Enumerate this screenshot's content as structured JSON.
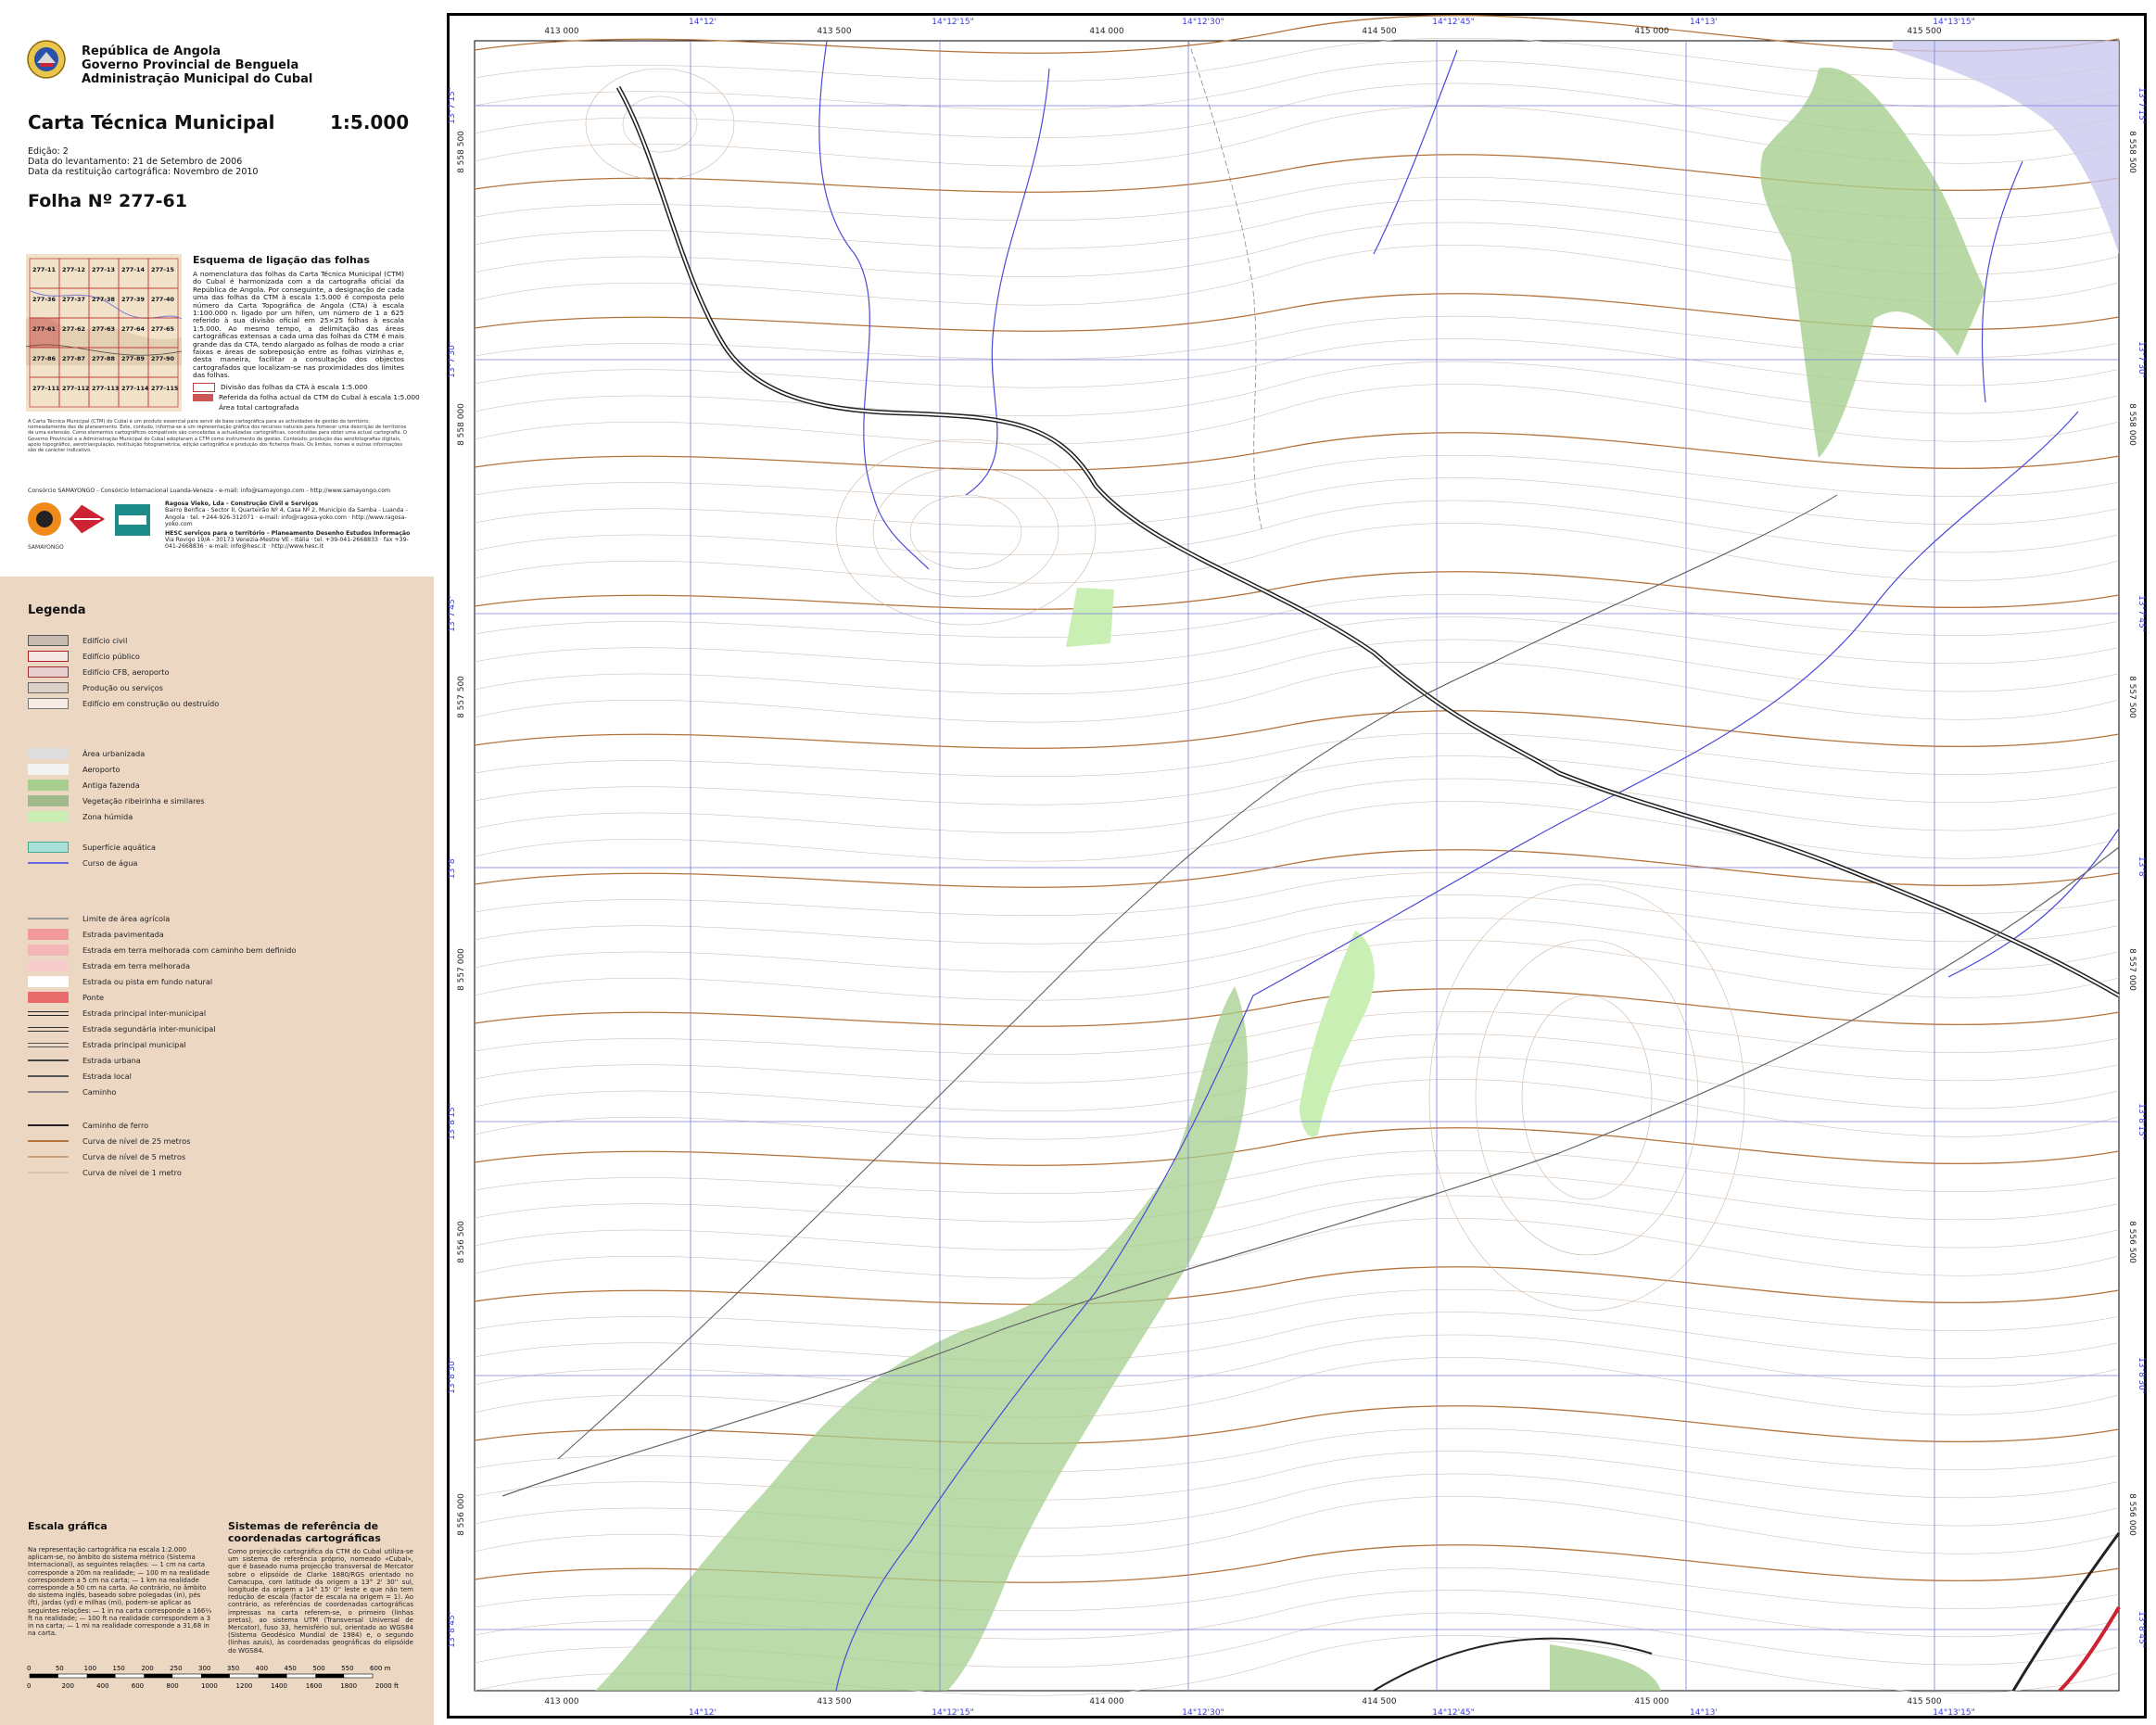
{
  "header": {
    "line1": "República de Angola",
    "line2": "Governo Provincial de Benguela",
    "line3": "Administração Municipal do Cubal"
  },
  "title": "Carta Técnica Municipal",
  "scale": "1:5.000",
  "meta": {
    "edition": "Edição: 2",
    "survey_date": "Data do levantamento: 21 de Setembro de 2006",
    "restitution_date": "Data da restituição cartográfica: Novembro de 2010"
  },
  "sheet": "Folha Nº  277-61",
  "index": {
    "title": "Esquema de ligação das folhas",
    "text": "A nomenclatura das folhas da Carta Técnica Municipal (CTM) do Cubal é harmonizada com a da cartografia oficial da República de Angola. Por conseguinte, a designação de cada uma das folhas da CTM à escala 1:5.000 é composta pelo número da Carta Topográfica de Angola (CTA) à escala 1:100.000 n. ligado por um hífen, um número de 1 a 625 referido à sua divisão oficial em 25×25 folhas à escala 1:5.000. Ao mesmo tempo, a delimitação das áreas cartográficas extensas a cada uma das folhas da CTM é mais grande das da CTA, tendo alargado as folhas de modo a criar faixas e áreas de sobreposição entre as folhas vizinhas e, desta maneira, facilitar a consultação dos objectos cartografados que localizam-se nas proximidades dos limites das folhas.",
    "cells": [
      [
        "277-11",
        "277-12",
        "277-13",
        "277-14",
        "277-15"
      ],
      [
        "277-36",
        "277-37",
        "277-38",
        "277-39",
        "277-40"
      ],
      [
        "277-61",
        "277-62",
        "277-63",
        "277-64",
        "277-65"
      ],
      [
        "277-86",
        "277-87",
        "277-88",
        "277-89",
        "277-90"
      ],
      [
        "277-111",
        "277-112",
        "277-113",
        "277-114",
        "277-115"
      ]
    ],
    "legend": [
      "Divisão das folhas da CTA à escala 1:5.000",
      "Referida da folha actual da CTM do Cubal à escala 1:5.000",
      "Área total cartografada"
    ]
  },
  "fine_print": "A Carta Técnica Municipal (CTM) do Cubal é um produto essencial para servir de base cartográfica para as actividades de gestão do território, nomeadamente das de planeamento. Este, contudo, informa-se a um representação gráfica dos recursos naturais para fornecer uma descrição de territórios de uma extensão. Como elementos cartográficos compatíveis são concebidas a actualizadas cartográficas, constituídas para obter uma actual cartografia. O Governo Provincial e a Administração Municipal do Cubal adoptaram a CTM como instrumento de gestão. Conteúdo: produção das aerofotografias digitais, apoio topográfico, aerotriangulação, restituição fotogramétrica, edição cartográfica e produção dos ficheiros finais. Os limites, nomes e outras informações são de carácter indicativo.",
  "consortium": {
    "line": "Consórcio SAMAYONGO - Consórcio Internacional Luanda-Veneza - e-mail: info@samayongo.com - http://www.samayongo.com",
    "logo_caption": "SAMAYONGO",
    "partner1_title": "Ragosa Vieko, Lda - Construção Civil e Serviços",
    "partner1_text": "Bairro Benfica - Sector II, Quarteirão Nº 4, Casa Nº 2, Município da Samba - Luanda - Angola · tel. +244-926-312071 · e-mail: info@ragosa-yoko.com · http://www.ragosa-yoko.com",
    "partner2_title": "HESC serviços para o território - Planeamento Desenho Estudos Informação",
    "partner2_text": "Via Rovigo 19/A - 30173 Venezia-Mestre VE - Itália · tel. +39-041-2668833 · fax +39-041-2668836 · e-mail: info@hesc.it · http://www.hesc.it"
  },
  "legend": {
    "title": "Legenda",
    "items": [
      {
        "label": "Edifício civil",
        "swatch": "box",
        "fill": "#c7bbb0",
        "stroke": "#555"
      },
      {
        "label": "Edifício público",
        "swatch": "box",
        "fill": "#f5e6e6",
        "stroke": "#b02020"
      },
      {
        "label": "Edifício CFB, aeroporto",
        "swatch": "box",
        "fill": "#e8d0d0",
        "stroke": "#a03030"
      },
      {
        "label": "Produção ou serviços",
        "swatch": "box",
        "fill": "#dcd2c8",
        "stroke": "#666"
      },
      {
        "label": "Edifício em construção ou destruído",
        "swatch": "box",
        "fill": "#f4ece4",
        "stroke": "#777"
      },
      {
        "label": "Área urbanizada",
        "swatch": "fill",
        "fill": "#dddddd",
        "stroke": "none"
      },
      {
        "label": "Aeroporto",
        "swatch": "fill",
        "fill": "#f3f3f3",
        "stroke": "none"
      },
      {
        "label": "Antiga fazenda",
        "swatch": "fill",
        "fill": "#a6cf8e",
        "stroke": "none"
      },
      {
        "label": "Vegetação ribeirinha e similares",
        "swatch": "fill",
        "fill": "#9fb98a",
        "stroke": "none"
      },
      {
        "label": "Zona húmida",
        "swatch": "fill",
        "fill": "#c9efb5",
        "stroke": "none"
      },
      {
        "label": "Superfície aquática",
        "swatch": "fill",
        "fill": "#a8e0da",
        "stroke": "#4a8"
      },
      {
        "label": "Curso de água",
        "swatch": "line",
        "fill": "#6a6ae0",
        "stroke": "none"
      },
      {
        "label": "Limite de área agrícola",
        "swatch": "line",
        "fill": "#999999",
        "stroke": "none"
      },
      {
        "label": "Estrada pavimentada",
        "swatch": "fill",
        "fill": "#f19a9a",
        "stroke": "none"
      },
      {
        "label": "Estrada em terra melhorada com caminho bem definido",
        "swatch": "fill",
        "fill": "#f4b6b6",
        "stroke": "none"
      },
      {
        "label": "Estrada em terra melhorada",
        "swatch": "fill",
        "fill": "#f6cccc",
        "stroke": "none"
      },
      {
        "label": "Estrada ou pista em fundo natural",
        "swatch": "fill",
        "fill": "#ffffff",
        "stroke": "none"
      },
      {
        "label": "Ponte",
        "swatch": "fill",
        "fill": "#e86b6b",
        "stroke": "none"
      },
      {
        "label": "Estrada principal inter-municipal",
        "swatch": "double",
        "fill": "#222",
        "stroke": "none"
      },
      {
        "label": "Estrada segundária inter-municipal",
        "swatch": "double",
        "fill": "#333",
        "stroke": "none"
      },
      {
        "label": "Estrada principal municipal",
        "swatch": "double",
        "fill": "#555",
        "stroke": "none"
      },
      {
        "label": "Estrada urbana",
        "swatch": "line",
        "fill": "#444",
        "stroke": "none"
      },
      {
        "label": "Estrada local",
        "swatch": "line",
        "fill": "#555",
        "stroke": "none"
      },
      {
        "label": "Caminho",
        "swatch": "line",
        "fill": "#888",
        "stroke": "none"
      },
      {
        "label": "Caminho de ferro",
        "swatch": "line",
        "fill": "#222",
        "stroke": "none"
      },
      {
        "label": "Curva de nível de 25 metros",
        "swatch": "line",
        "fill": "#b4733a",
        "stroke": "none"
      },
      {
        "label": "Curva de nível de 5 metros",
        "swatch": "line",
        "fill": "#c9a07a",
        "stroke": "none"
      },
      {
        "label": "Curva de nível de 1 metro",
        "swatch": "line",
        "fill": "#d8c3ad",
        "stroke": "none"
      }
    ]
  },
  "scale_section": {
    "title": "Escala gráfica",
    "text": "Na representação cartográfica na escala 1:2.000 aplicam-se, no âmbito do sistema métrico (Sistema Internacional), as seguintes relações: — 1 cm na carta corresponde a 20m na realidade; — 100 m na realidade correspondem a 5 cm na carta; — 1 km na realidade corresponde a 50 cm na carta. Ao contrário, no âmbito do sistema inglês, baseado sobre polegadas (in), pés (ft), jardas (yd) e milhas (mi), podem-se aplicar as seguintes relações: — 1 in na carta corresponde a 166⅔ ft na realidade; — 100 ft na realidade correspondem a 3 in na carta; — 1 mi na realidade corresponde a 31,68 in na carta.",
    "ticks_m": [
      "0",
      "50",
      "100",
      "150",
      "200",
      "250",
      "300",
      "350",
      "400",
      "450",
      "500",
      "550",
      "600 m"
    ],
    "ticks_ft": [
      "0",
      "200",
      "400",
      "600",
      "800",
      "1000",
      "1200",
      "1400",
      "1600",
      "1800",
      "2000 ft"
    ]
  },
  "ref_section": {
    "title": "Sistemas de referência de coordenadas cartográficas",
    "text": "Como projecção cartográfica da CTM do Cubal utiliza-se um sistema de referência próprio, nomeado «Cubal», que é baseado numa projecção transversal de Mercator sobre o elipsóide de Clarke 1880/RGS orientado no Camacupa, com latitude da origem a 13° 2' 30'' sul, longitude da origem a 14° 15' 0'' leste e que não tem redução de escala (factor de escala na origem = 1). Ao contrário, as referências de coordenadas cartográficas impressas na carta referem-se, o primeiro (linhas pretas), ao sistema UTM (Transversal Universal de Mercator), fuso 33, hemisfério sul, orientado ao WGS84 (Sistema Geodésico Mundial de 1984) e, o segundo (linhas azuis), às coordenadas geográficas do elipsóide do WGS84."
  },
  "map": {
    "top_easting": [
      "413 000",
      "413 500",
      "414 000",
      "414 500",
      "415 000",
      "415 500"
    ],
    "bottom_easting": [
      "413 000",
      "413 500",
      "414 000",
      "414 500",
      "415 000",
      "415 500"
    ],
    "top_longitude": [
      "14°12'",
      "14°12'15\"",
      "14°12'30\"",
      "14°12'45\"",
      "14°13'",
      "14°13'15\""
    ],
    "bottom_longitude": [
      "14°12'",
      "14°12'15\"",
      "14°12'30\"",
      "14°12'45\"",
      "14°13'",
      "14°13'15\""
    ],
    "left_northing": [
      "8 558 500",
      "8 558 000",
      "8 557 500",
      "8 557 000",
      "8 556 500",
      "8 556 000"
    ],
    "right_northing": [
      "8 558 500",
      "8 558 000",
      "8 557 500",
      "8 557 000",
      "8 556 500",
      "8 556 000"
    ],
    "left_latitude": [
      "13°7'15\"",
      "13°7'30\"",
      "13°7'45\"",
      "13°8'",
      "13°8'15\"",
      "13°8'30\"",
      "13°8'45\""
    ],
    "right_latitude": [
      "13°7'15\"",
      "13°7'30\"",
      "13°7'45\"",
      "13°8'",
      "13°8'15\"",
      "13°8'30\"",
      "13°8'45\""
    ]
  }
}
